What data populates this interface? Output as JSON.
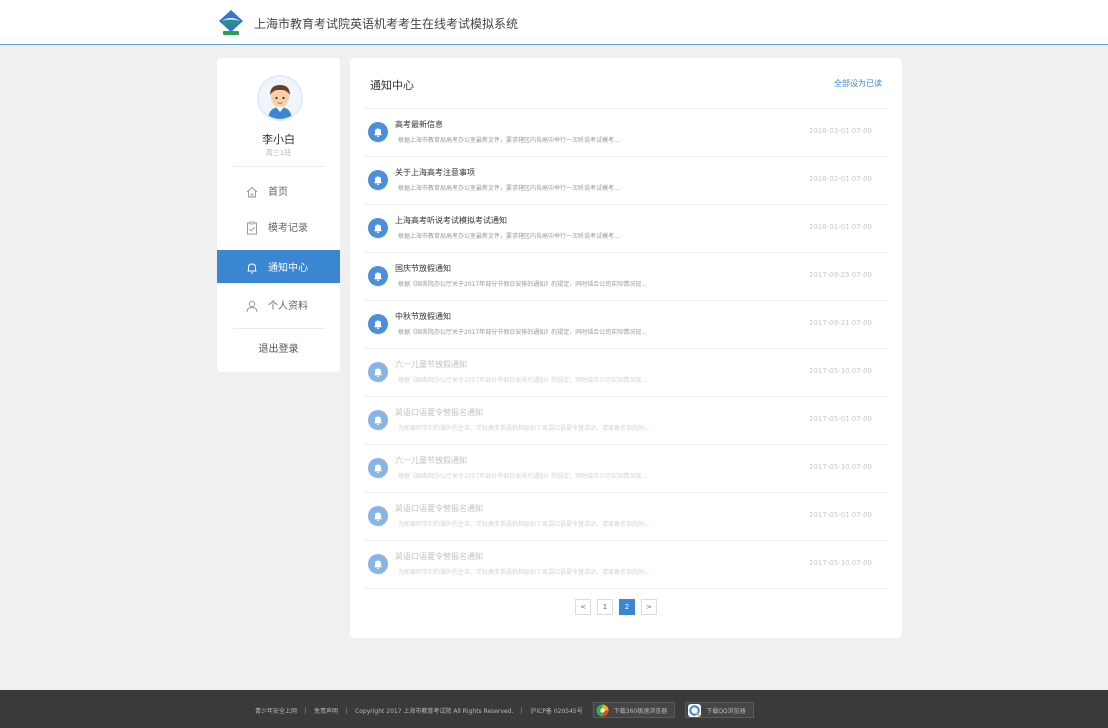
{
  "header": {
    "site_title": "上海市教育考试院英语机考考生在线考试模拟系统",
    "logo_icon": "exam-authority-logo-icon"
  },
  "sidebar": {
    "user": {
      "name": "李小白",
      "class_name": "高三1班",
      "avatar_icon": "boy-avatar-icon"
    },
    "items": [
      {
        "label": "首页",
        "icon": "home-icon",
        "active": false
      },
      {
        "label": "模考记录",
        "icon": "clipboard-check-icon",
        "active": false
      },
      {
        "label": "通知中心",
        "icon": "bell-icon",
        "active": true
      },
      {
        "label": "个人资料",
        "icon": "person-icon",
        "active": false
      }
    ],
    "logout_label": "退出登录"
  },
  "panel": {
    "title": "通知中心",
    "mark_all_read": "全部设为已读",
    "notices": [
      {
        "title": "高考最新信息",
        "excerpt": "根据上海市教育局高考办公室最新文件，要求辖区内各高中举行一次听说考试模考...",
        "time": "2018-03-01 07:00",
        "read": false
      },
      {
        "title": "关于上海高考注意事项",
        "excerpt": "根据上海市教育局高考办公室最新文件，要求辖区内各高中举行一次听说考试模考...",
        "time": "2018-02-01 07:00",
        "read": false
      },
      {
        "title": "上海高考听说考试模拟考试通知",
        "excerpt": "根据上海市教育局高考办公室最新文件，要求辖区内各高中举行一次听说考试模考...",
        "time": "2018-01-01 07:00",
        "read": false
      },
      {
        "title": "国庆节放假通知",
        "excerpt": "根据《国务院办公厅关于2017年部分节假日安排的通知》的规定，同时结合公司实际情况现...",
        "time": "2017-09-25 07:00",
        "read": false
      },
      {
        "title": "中秋节放假通知",
        "excerpt": "根据《国务院办公厅关于2017年部分节假日安排的通知》的规定，同时结合公司实际情况现...",
        "time": "2017-09-21 07:00",
        "read": false
      },
      {
        "title": "六一儿童节放假通知",
        "excerpt": "根据《国务院办公厅关于2017年部分节假日安排的通知》的规定，同时结合公司实际情况现...",
        "time": "2017-05-30 07:00",
        "read": true
      },
      {
        "title": "英语口语夏令营报名通知",
        "excerpt": "为拓展同学们的课外的生活，学校携手英语机构组织了英语口语夏令营活动，请准备参加的同...",
        "time": "2017-05-01 07:00",
        "read": true
      },
      {
        "title": "六一儿童节放假通知",
        "excerpt": "根据《国务院办公厅关于2017年部分节假日安排的通知》的规定，同时结合公司实际情况现...",
        "time": "2017-05-30 07:00",
        "read": true
      },
      {
        "title": "英语口语夏令营报名通知",
        "excerpt": "为拓展同学们的课外的生活，学校携手英语机构组织了英语口语夏令营活动，请准备参加的同...",
        "time": "2017-05-01 07:00",
        "read": true
      },
      {
        "title": "英语口语夏令营报名通知",
        "excerpt": "为拓展同学们的课外的生活，学校携手英语机构组织了英语口语夏令营活动，请准备参加的同...",
        "time": "2017-05-30 07:00",
        "read": true
      }
    ],
    "pagination": {
      "prev": "<",
      "pages": [
        "1",
        "2"
      ],
      "current_page": "2",
      "next": ">"
    }
  },
  "footer": {
    "links": [
      "青少年安全上网",
      "免责声明",
      "Copyright 2017  上海市教育考试院  All Rights Reserved.",
      "沪ICP备 020545号"
    ],
    "download_360": "下载360极速浏览器",
    "download_qq": "下载QQ浏览器"
  },
  "colors": {
    "accent": "#3a86d1",
    "bell": "#4a90d9",
    "footer_bg": "#3a3a3a",
    "page_bg": "#f0f0f0"
  }
}
